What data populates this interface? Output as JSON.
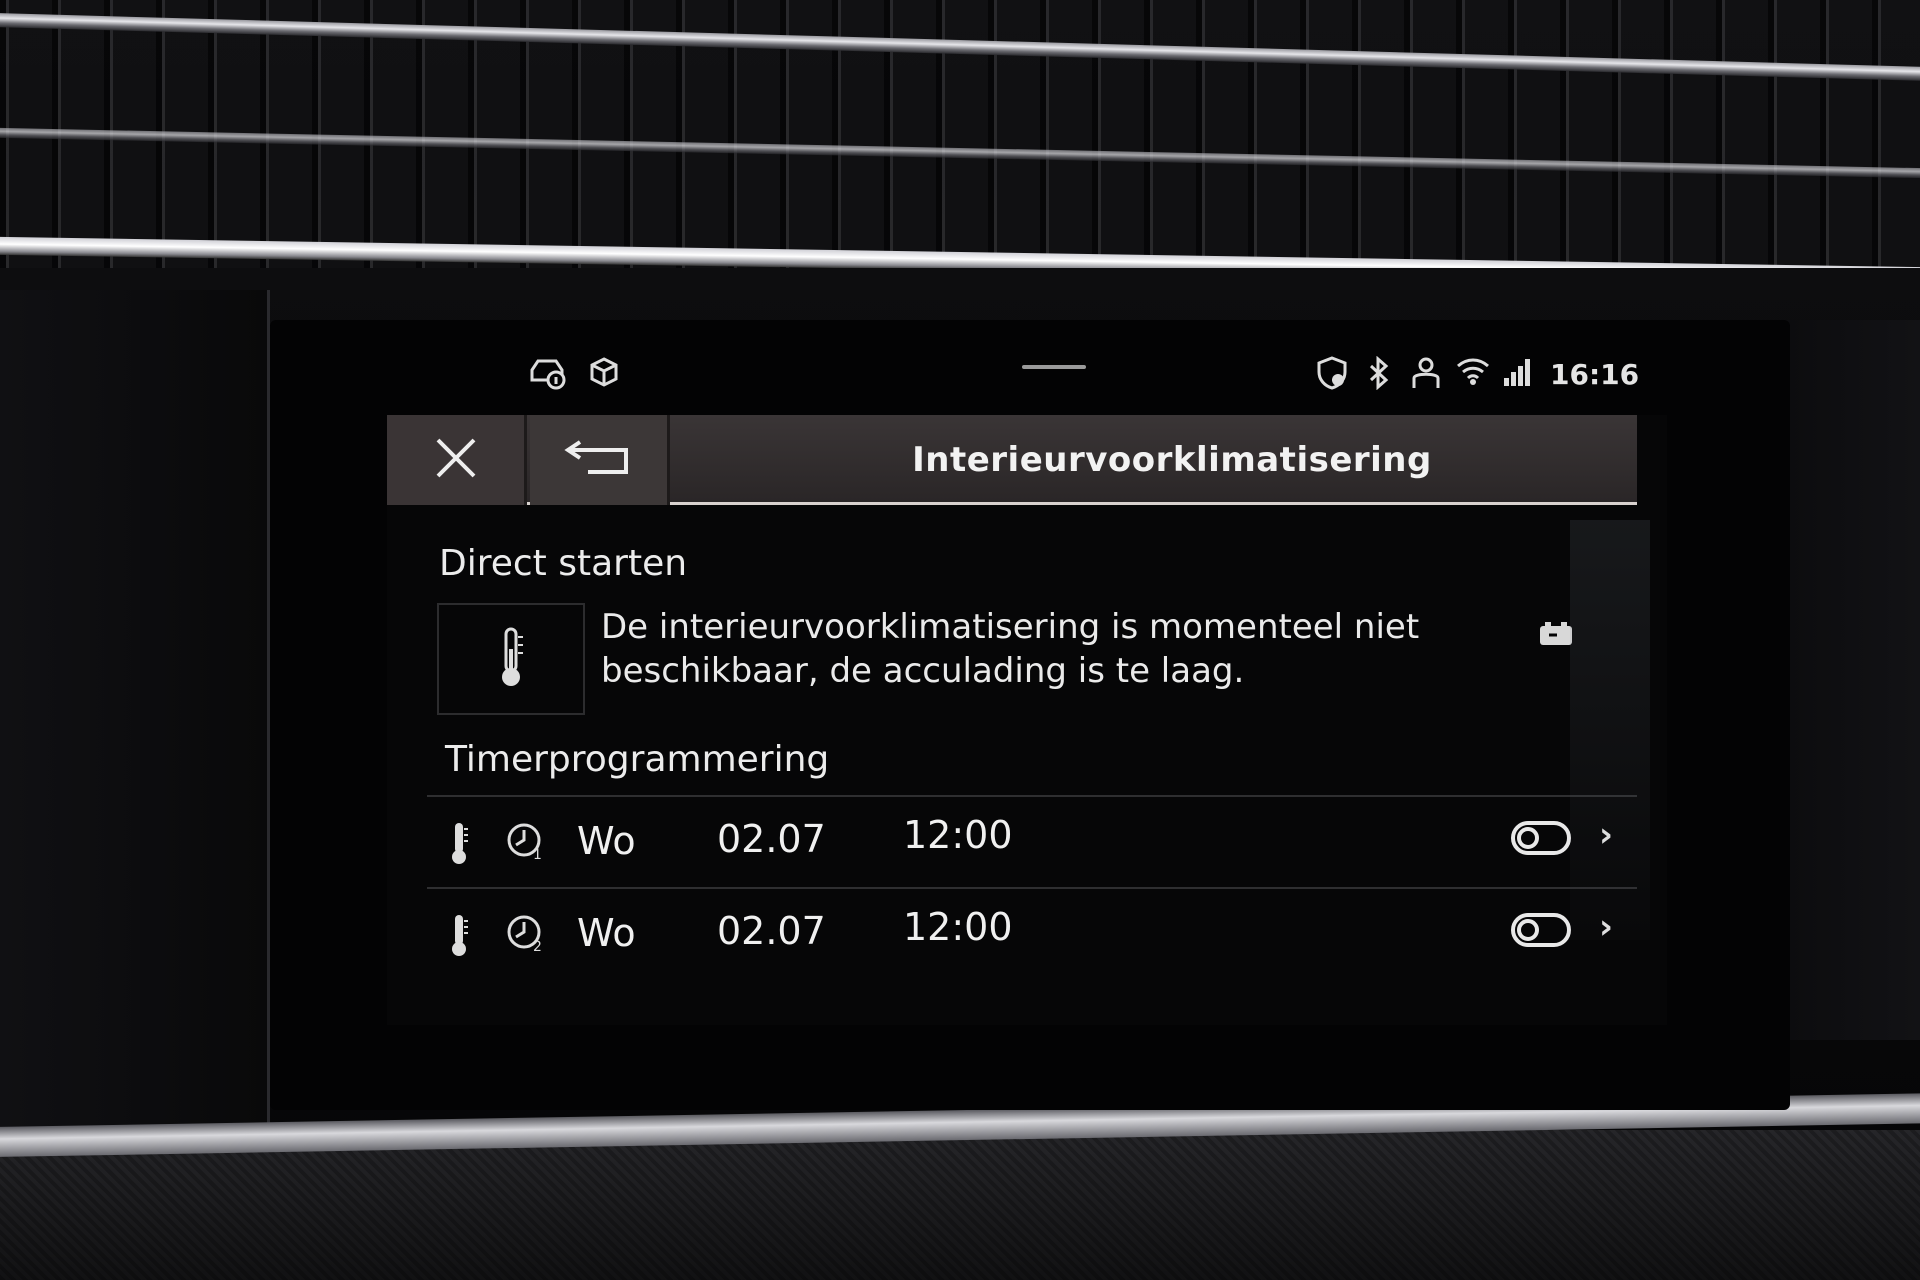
{
  "status_bar": {
    "icons": [
      "car-info-icon",
      "package-icon",
      "shield-icon",
      "bluetooth-icon",
      "user-icon",
      "wifi-icon",
      "signal-icon"
    ],
    "time": "16:16"
  },
  "dialog": {
    "title": "Interieurvoorklimatisering",
    "close_icon": "close-icon",
    "back_icon": "back-icon"
  },
  "direct_start": {
    "heading": "Direct starten",
    "message_line1": "De interieurvoorklimatisering is momenteel niet",
    "message_line2": "beschikbaar, de acculading is te laag."
  },
  "timer": {
    "heading": "Timerprogrammering",
    "rows": [
      {
        "timer_number": "1",
        "day": "Wo",
        "date": "02.07",
        "time": "12:00",
        "enabled": false
      },
      {
        "timer_number": "2",
        "day": "Wo",
        "date": "02.07",
        "time": "12:00",
        "enabled": false
      }
    ]
  },
  "colors": {
    "title_bar": "#2f2a2b",
    "text": "#ececec",
    "background": "#030304"
  }
}
